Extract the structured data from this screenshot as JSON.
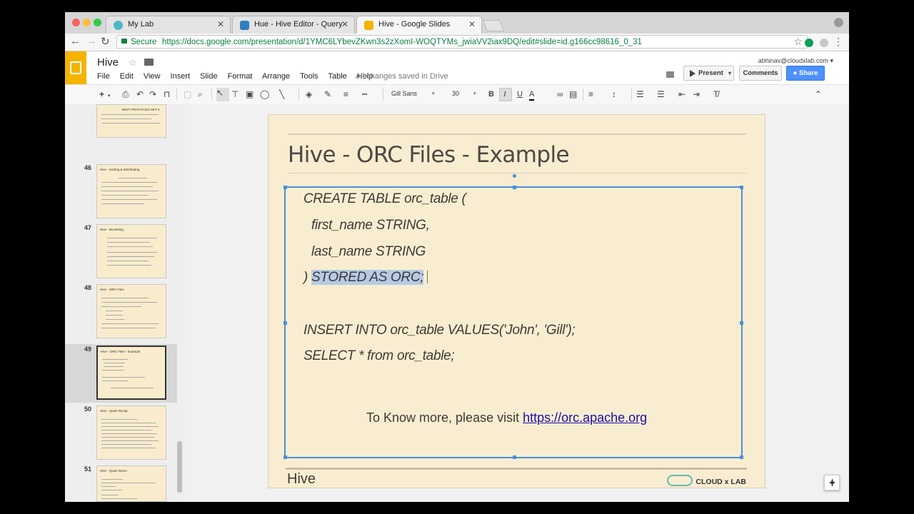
{
  "browser": {
    "tabs": [
      {
        "label": "My Lab",
        "icon": "cloudxlab-icon",
        "icon_color": "#4fb8c6"
      },
      {
        "label": "Hue - Hive Editor - Query",
        "icon": "hue-icon",
        "icon_color": "#2f7fc1"
      },
      {
        "label": "Hive - Google Slides",
        "icon": "google-slides-icon",
        "icon_color": "#f4b400"
      }
    ],
    "tab_close": "✕",
    "secure_label": "Secure",
    "url": "https://docs.google.com/presentation/d/1YMC6LYbevZKwn3s2zXomI-WOQTYMs_jwiaVV2iax9DQ/edit#slide=id.g166cc98616_0_31"
  },
  "docs": {
    "title": "Hive",
    "menu": [
      "File",
      "Edit",
      "View",
      "Insert",
      "Slide",
      "Format",
      "Arrange",
      "Tools",
      "Table",
      "Help"
    ],
    "save_status": "All changes saved in Drive",
    "account": "abhinav@cloudxlab.com",
    "present_label": "Present",
    "comments_label": "Comments",
    "share_label": "Share",
    "font_name": "Gill Sans",
    "font_size": "30"
  },
  "filmstrip": {
    "slides": [
      {
        "number": "",
        "title": "BEST PRACTICES SET-4"
      },
      {
        "number": "46",
        "title": "Hive - Sorting & Distributing"
      },
      {
        "number": "47",
        "title": "Hive - Bucketing"
      },
      {
        "number": "48",
        "title": "Hive - ORC Files"
      },
      {
        "number": "49",
        "title": "Hive - ORC Files - Example"
      },
      {
        "number": "50",
        "title": "Hive - Quick Recap"
      },
      {
        "number": "51",
        "title": "Hive - Quick Demo"
      }
    ]
  },
  "slide": {
    "title": "Hive - ORC Files - Example",
    "code": [
      "CREATE TABLE orc_table (",
      "first_name STRING,",
      "last_name STRING",
      ")",
      "STORED AS ORC;",
      "INSERT INTO orc_table VALUES('John', 'Gill');",
      "SELECT * from orc_table;"
    ],
    "visit_text": "To Know more, please visit",
    "visit_link": "https://orc.apache.org",
    "footer": "Hive",
    "brand": "CLOUD x LAB"
  },
  "colors": {
    "accent_blue": "#4a90d9",
    "slide_bg": "#f9edd1",
    "share_blue": "#4d90fe",
    "slides_yellow": "#f4b400",
    "secure_green": "#0b8043"
  }
}
